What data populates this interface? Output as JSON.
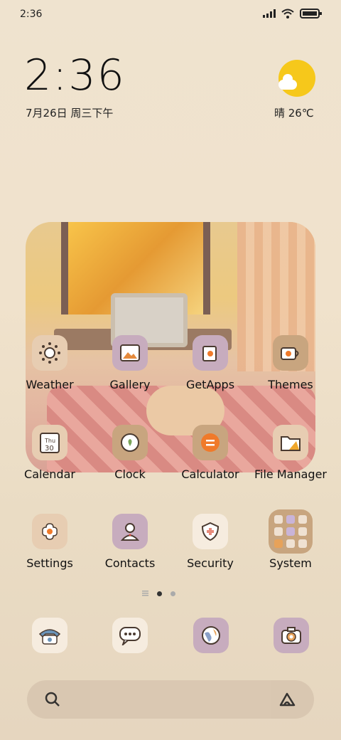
{
  "status_bar": {
    "time": "2:36"
  },
  "clock": {
    "time": "2:36",
    "date": "7月26日 周三下午"
  },
  "weather": {
    "text": "晴 26℃"
  },
  "grid_apps": [
    {
      "label": "Weather"
    },
    {
      "label": "Gallery"
    },
    {
      "label": "GetApps"
    },
    {
      "label": "Themes"
    },
    {
      "label": "Calendar"
    },
    {
      "label": "Clock"
    },
    {
      "label": "Calculator"
    },
    {
      "label": "File Manager"
    },
    {
      "label": "Settings"
    },
    {
      "label": "Contacts"
    },
    {
      "label": "Security"
    },
    {
      "label": "System"
    }
  ],
  "calendar_icon": {
    "day": "Thu",
    "date": "30"
  },
  "page_indicator": {
    "current": 1,
    "total": 2
  },
  "dock": [
    "phone-icon",
    "messages-icon",
    "browser-icon",
    "camera-icon"
  ],
  "colors": {
    "sun": "#f6c81b",
    "icon_tan": "#c8a57f",
    "icon_lavender": "#c7acbe",
    "calculator_orange": "#f07a2a"
  }
}
